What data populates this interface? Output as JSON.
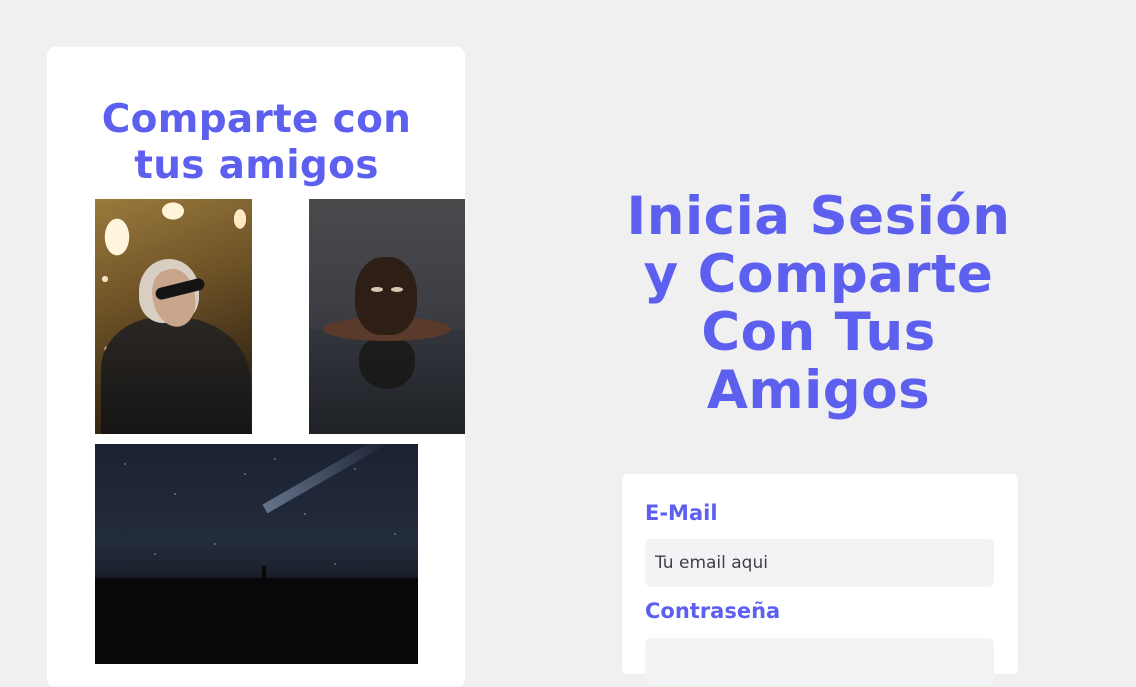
{
  "hero": {
    "card_title": "Comparte con tus amigos"
  },
  "login": {
    "title": "Inicia Sesión y Comparte Con Tus Amigos",
    "email_label": "E-Mail",
    "email_placeholder": "Tu email aqui",
    "password_label": "Contraseña",
    "password_placeholder": ""
  },
  "colors": {
    "accent": "#5d5fef",
    "background": "#f0f0f1",
    "card": "#ffffff",
    "input_background": "#f2f3f5"
  }
}
